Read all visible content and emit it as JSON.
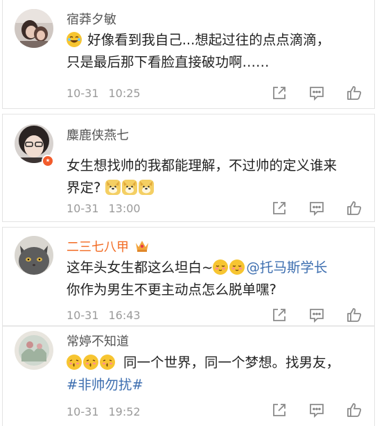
{
  "comments": [
    {
      "username": "宿莽夕敏",
      "text_main": "好像看到我自己...想起过往的点点滴滴，",
      "text_line2": "只是最后那下看脸直接破功啊……",
      "date": "10-31",
      "time": "10:25",
      "emoji_lead": "laugh-cry-emoji"
    },
    {
      "username": "麋鹿侠燕七",
      "text_main": "女生想找帅的我都能理解，不过帅的定义谁来",
      "text_line2": "界定?",
      "date": "10-31",
      "time": "13:00",
      "emoji_tail": [
        "doge-emoji",
        "doge-emoji",
        "doge-emoji"
      ]
    },
    {
      "username": "二三七八甲",
      "text_main": "这年头女生都这么坦白~",
      "mention": "@托马斯学长",
      "text_line2": "你作为男生不更主动点怎么脱单嘿?",
      "date": "10-31",
      "time": "16:43",
      "emoji_mid": [
        "shy-emoji",
        "shy-emoji"
      ]
    },
    {
      "username": "常婷不知道",
      "text_main": "同一个世界，同一个梦想。找男友，",
      "hashtag": "#非帅勿扰#",
      "date": "10-31",
      "time": "19:52",
      "emoji_lead": [
        "kiss-emoji",
        "kiss-emoji",
        "kiss-emoji"
      ]
    }
  ],
  "icons": {
    "repost": "repost-icon",
    "comment": "comment-icon",
    "like": "thumbs-up-icon",
    "vip": "crown-icon"
  },
  "colors": {
    "name": "#555555",
    "vip_name": "#f26a21",
    "link": "#3e6fb0",
    "meta": "#9a9a9a"
  }
}
